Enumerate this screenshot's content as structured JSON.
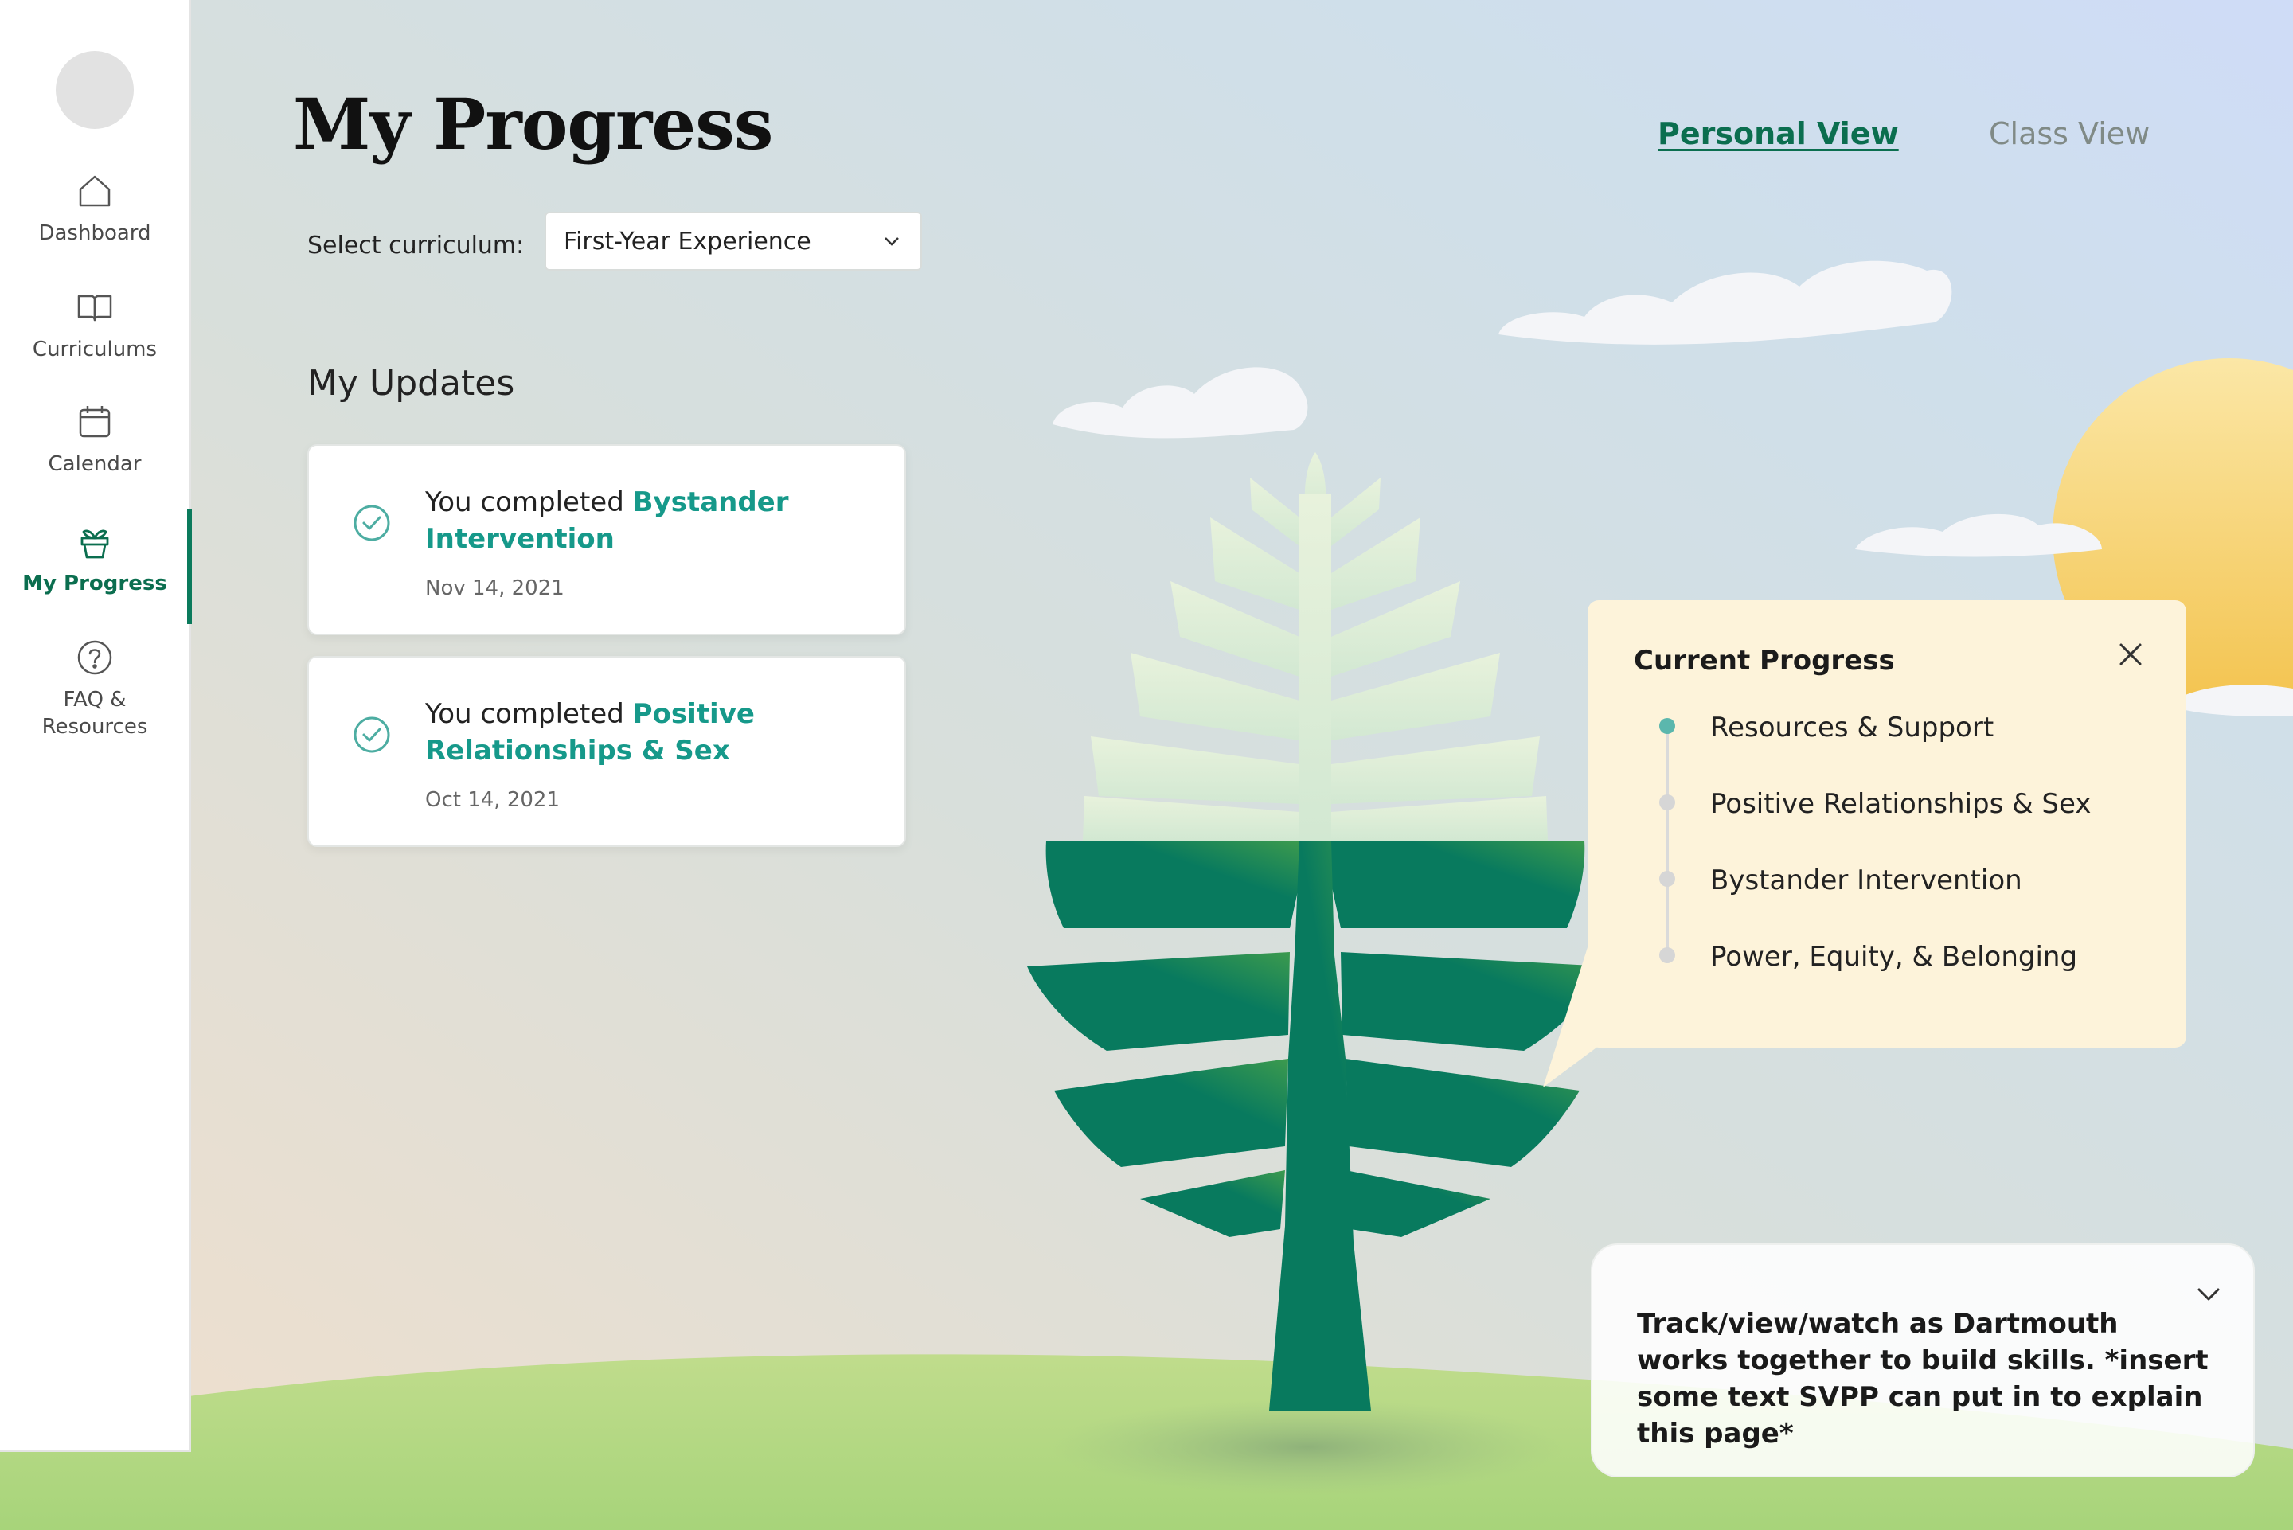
{
  "sidebar": {
    "items": [
      {
        "label": "Dashboard",
        "icon": "home-icon"
      },
      {
        "label": "Curriculums",
        "icon": "book-icon"
      },
      {
        "label": "Calendar",
        "icon": "calendar-icon"
      },
      {
        "label": "My Progress",
        "icon": "plant-pot-icon",
        "active": true
      },
      {
        "label": "FAQ & Resources",
        "icon": "help-circle-icon"
      }
    ]
  },
  "header": {
    "title": "My Progress",
    "tabs": {
      "personal": "Personal View",
      "class": "Class View"
    }
  },
  "curriculum": {
    "label": "Select curriculum:",
    "selected": "First-Year Experience"
  },
  "updates": {
    "title": "My Updates",
    "items": [
      {
        "prefix": "You completed ",
        "highlight": "Bystander Intervention",
        "date": "Nov 14, 2021"
      },
      {
        "prefix": "You completed ",
        "highlight": "Positive Relationships & Sex",
        "date": "Oct 14, 2021"
      }
    ]
  },
  "progress_popover": {
    "title": "Current Progress",
    "items": [
      {
        "label": "Resources & Support",
        "done": true
      },
      {
        "label": "Positive Relationships & Sex",
        "done": false
      },
      {
        "label": "Bystander Intervention",
        "done": false
      },
      {
        "label": "Power, Equity, & Belonging",
        "done": false
      }
    ]
  },
  "info_panel": {
    "text": "Track/view/watch as Dartmouth works together to build skills. *insert some text SVPP can put in to explain this page*"
  },
  "colors": {
    "brand_green": "#0b6e4f",
    "teal_accent": "#16998a",
    "popover_bg": "#fdf3da"
  }
}
